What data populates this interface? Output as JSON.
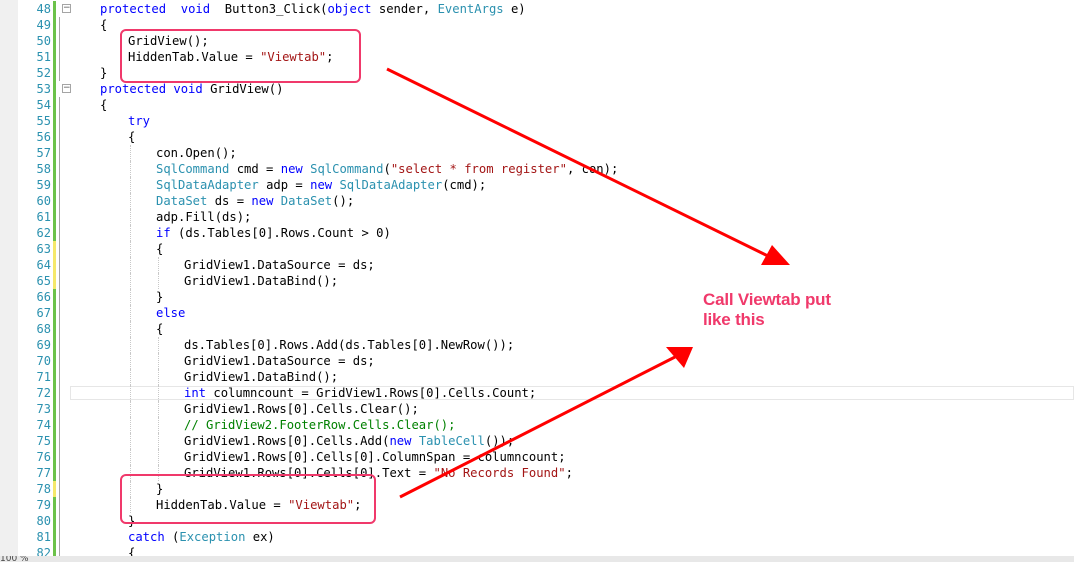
{
  "editor": {
    "zoom": "100 %",
    "lines": [
      {
        "n": "48",
        "indent": 0,
        "fold": "-",
        "chg": "green",
        "tokens": [
          [
            "kw",
            "protected"
          ],
          [
            "",
            "  "
          ],
          [
            "kw",
            "void"
          ],
          [
            "",
            "  Button3_Click("
          ],
          [
            "kw",
            "object"
          ],
          [
            "",
            " sender, "
          ],
          [
            "ty",
            "EventArgs"
          ],
          [
            "",
            " e)"
          ]
        ]
      },
      {
        "n": "49",
        "indent": 0,
        "chg": "green",
        "tokens": [
          [
            "",
            "{"
          ]
        ]
      },
      {
        "n": "50",
        "indent": 1,
        "chg": "green",
        "tokens": [
          [
            "",
            "GridView();"
          ]
        ]
      },
      {
        "n": "51",
        "indent": 1,
        "chg": "green",
        "tokens": [
          [
            "",
            "HiddenTab.Value = "
          ],
          [
            "st",
            "\"Viewtab\""
          ],
          [
            "",
            ";"
          ]
        ]
      },
      {
        "n": "52",
        "indent": 0,
        "chg": "green",
        "tokens": [
          [
            "",
            "}"
          ]
        ]
      },
      {
        "n": "53",
        "indent": 0,
        "fold": "-",
        "chg": "green",
        "tokens": [
          [
            "kw",
            "protected"
          ],
          [
            "",
            ""
          ],
          [
            "kw",
            " void"
          ],
          [
            "",
            " GridView()"
          ]
        ]
      },
      {
        "n": "54",
        "indent": 0,
        "chg": "green",
        "tokens": [
          [
            "",
            "{"
          ]
        ]
      },
      {
        "n": "55",
        "indent": 1,
        "chg": "green",
        "tokens": [
          [
            "kw",
            "try"
          ]
        ]
      },
      {
        "n": "56",
        "indent": 1,
        "chg": "green",
        "tokens": [
          [
            "",
            "{"
          ]
        ]
      },
      {
        "n": "57",
        "indent": 2,
        "chg": "green",
        "tokens": [
          [
            "",
            "con.Open();"
          ]
        ]
      },
      {
        "n": "58",
        "indent": 2,
        "chg": "green",
        "tokens": [
          [
            "ty",
            "SqlCommand"
          ],
          [
            "",
            " cmd = "
          ],
          [
            "kw",
            "new"
          ],
          [
            "",
            " "
          ],
          [
            "ty",
            "SqlCommand"
          ],
          [
            "",
            "("
          ],
          [
            "st",
            "\"select * from register\""
          ],
          [
            "",
            ", con);"
          ]
        ]
      },
      {
        "n": "59",
        "indent": 2,
        "chg": "green",
        "tokens": [
          [
            "ty",
            "SqlDataAdapter"
          ],
          [
            "",
            " adp = "
          ],
          [
            "kw",
            "new"
          ],
          [
            "",
            " "
          ],
          [
            "ty",
            "SqlDataAdapter"
          ],
          [
            "",
            "(cmd);"
          ]
        ]
      },
      {
        "n": "60",
        "indent": 2,
        "chg": "green",
        "tokens": [
          [
            "ty",
            "DataSet"
          ],
          [
            "",
            " ds = "
          ],
          [
            "kw",
            "new"
          ],
          [
            "",
            " "
          ],
          [
            "ty",
            "DataSet"
          ],
          [
            "",
            "();"
          ]
        ]
      },
      {
        "n": "61",
        "indent": 2,
        "chg": "green",
        "tokens": [
          [
            "",
            "adp.Fill(ds);"
          ]
        ]
      },
      {
        "n": "62",
        "indent": 2,
        "chg": "green",
        "tokens": [
          [
            "kw",
            "if"
          ],
          [
            "",
            " (ds.Tables[0].Rows.Count > 0)"
          ]
        ]
      },
      {
        "n": "63",
        "indent": 2,
        "chg": "yellow",
        "tokens": [
          [
            "",
            "{"
          ]
        ]
      },
      {
        "n": "64",
        "indent": 3,
        "chg": "yellow",
        "tokens": [
          [
            "",
            "GridView1.DataSource = ds;"
          ]
        ]
      },
      {
        "n": "65",
        "indent": 3,
        "chg": "yellow",
        "tokens": [
          [
            "",
            "GridView1.DataBind();"
          ]
        ]
      },
      {
        "n": "66",
        "indent": 2,
        "chg": "green",
        "tokens": [
          [
            "",
            "}"
          ]
        ]
      },
      {
        "n": "67",
        "indent": 2,
        "chg": "green",
        "tokens": [
          [
            "kw",
            "else"
          ]
        ]
      },
      {
        "n": "68",
        "indent": 2,
        "chg": "green",
        "tokens": [
          [
            "",
            "{"
          ]
        ]
      },
      {
        "n": "69",
        "indent": 3,
        "chg": "green",
        "tokens": [
          [
            "",
            "ds.Tables[0].Rows.Add(ds.Tables[0].NewRow());"
          ]
        ]
      },
      {
        "n": "70",
        "indent": 3,
        "chg": "green",
        "tokens": [
          [
            "",
            "GridView1.DataSource = ds;"
          ]
        ]
      },
      {
        "n": "71",
        "indent": 3,
        "chg": "green",
        "tokens": [
          [
            "",
            "GridView1.DataBind();"
          ]
        ]
      },
      {
        "n": "72",
        "indent": 3,
        "chg": "green",
        "current": true,
        "tokens": [
          [
            "kw",
            "int"
          ],
          [
            "",
            " columncount = GridView1.Rows[0].Cells.Count;"
          ]
        ]
      },
      {
        "n": "73",
        "indent": 3,
        "chg": "green",
        "tokens": [
          [
            "",
            "GridView1.Rows[0].Cells.Clear();"
          ]
        ]
      },
      {
        "n": "74",
        "indent": 3,
        "chg": "green",
        "tokens": [
          [
            "cm",
            "// GridView2.FooterRow.Cells.Clear();"
          ]
        ]
      },
      {
        "n": "75",
        "indent": 3,
        "chg": "green",
        "tokens": [
          [
            "",
            "GridView1.Rows[0].Cells.Add("
          ],
          [
            "kw",
            "new"
          ],
          [
            "",
            " "
          ],
          [
            "ty",
            "TableCell"
          ],
          [
            "",
            "());"
          ]
        ]
      },
      {
        "n": "76",
        "indent": 3,
        "chg": "green",
        "tokens": [
          [
            "",
            "GridView1.Rows[0].Cells[0].ColumnSpan = columncount;"
          ]
        ]
      },
      {
        "n": "77",
        "indent": 3,
        "chg": "green",
        "tokens": [
          [
            "",
            "GridView1.Rows[0].Cells[0].Text = "
          ],
          [
            "st",
            "\"No Records Found\""
          ],
          [
            "",
            ";"
          ]
        ]
      },
      {
        "n": "78",
        "indent": 2,
        "chg": "yellow",
        "tokens": [
          [
            "",
            "}"
          ]
        ]
      },
      {
        "n": "79",
        "indent": 2,
        "chg": "green",
        "tokens": [
          [
            "",
            "HiddenTab.Value = "
          ],
          [
            "st",
            "\"Viewtab\""
          ],
          [
            "",
            ";"
          ]
        ]
      },
      {
        "n": "80",
        "indent": 1,
        "chg": "green",
        "tokens": [
          [
            "",
            "}"
          ]
        ]
      },
      {
        "n": "81",
        "indent": 1,
        "chg": "green",
        "tokens": [
          [
            "kw",
            "catch"
          ],
          [
            "",
            " ("
          ],
          [
            "ty",
            "Exception"
          ],
          [
            "",
            " ex)"
          ]
        ]
      },
      {
        "n": "82",
        "indent": 1,
        "chg": "green",
        "tokens": [
          [
            "",
            "{"
          ]
        ]
      }
    ]
  },
  "annotation": {
    "line1": "Call Viewtab put",
    "line2": "like this",
    "color": "#f0396b",
    "arrow_color": "#ff0000"
  },
  "colors": {
    "keyword": "#0000ff",
    "type": "#2b91af",
    "string": "#a31515",
    "comment": "#008000",
    "change_saved": "#6cc24a",
    "change_unsaved": "#f5e86a"
  }
}
